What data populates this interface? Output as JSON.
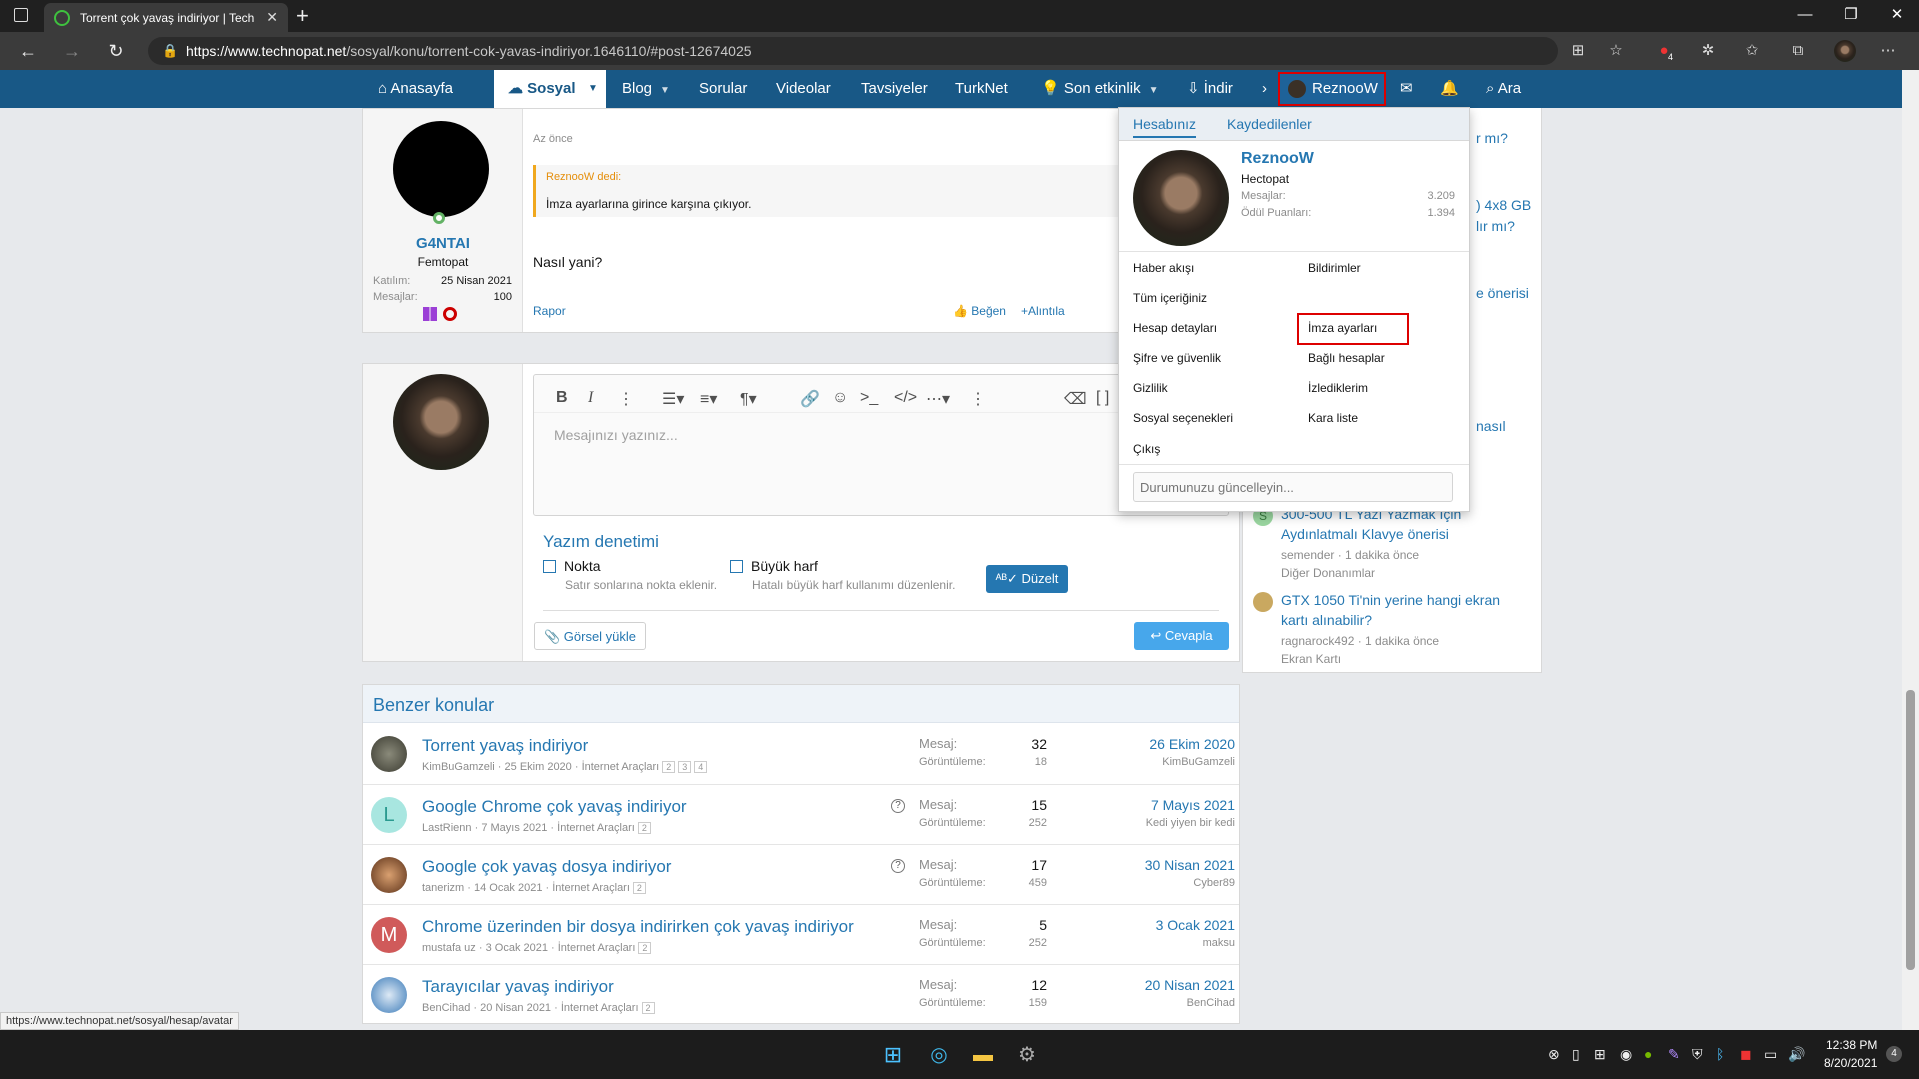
{
  "browser": {
    "tab_title": "Torrent çok yavaş indiriyor | Tech",
    "url_host": "https://www.technopat.net",
    "url_path": "/sosyal/konu/torrent-cok-yavas-indiriyor.1646110/#post-12674025",
    "badge_count": "4"
  },
  "nav": {
    "home": "Anasayfa",
    "sosyal": "Sosyal",
    "blog": "Blog",
    "sorular": "Sorular",
    "videolar": "Videolar",
    "tavsiyeler": "Tavsiyeler",
    "turknet": "TurkNet",
    "son_etkinlik": "Son etkinlik",
    "indir": "İndir",
    "user": "ReznooW",
    "ara": "Ara"
  },
  "post": {
    "time": "Az önce",
    "username": "G4NTAI",
    "rank": "Femtopat",
    "joined_label": "Katılım:",
    "joined_value": "25 Nisan 2021",
    "messages_label": "Mesajlar:",
    "messages_value": "100",
    "quote_author": "ReznooW dedi:",
    "quote_text": "İmza ayarlarına girince karşına çıkıyor.",
    "body": "Nasıl yani?",
    "report": "Rapor",
    "like": "Beğen",
    "quote": "Alıntıla"
  },
  "reply": {
    "placeholder": "Mesajınızı yazınız...",
    "spell_title": "Yazım denetimi",
    "opt1_label": "Nokta",
    "opt1_desc": "Satır sonlarına nokta eklenir.",
    "opt2_label": "Büyük harf",
    "opt2_desc": "Hatalı büyük harf kullanımı düzenlenir.",
    "fix_button": "Düzelt",
    "upload_button": "Görsel yükle",
    "reply_button": "Cevapla"
  },
  "similar": {
    "title": "Benzer konular",
    "mesaj_label": "Mesaj:",
    "goruntuleme_label": "Görüntüleme:",
    "rows": [
      {
        "title": "Torrent yavaş indiriyor",
        "author": "KimBuGamzeli",
        "date": "25 Ekim 2020",
        "forum": "İnternet Araçları",
        "pages": [
          "2",
          "3",
          "4"
        ],
        "messages": "32",
        "views": "18",
        "last_date": "26 Ekim 2020",
        "last_user": "KimBuGamzeli",
        "question": false
      },
      {
        "title": "Google Chrome çok yavaş indiriyor",
        "author": "LastRienn",
        "date": "7 Mayıs 2021",
        "forum": "İnternet Araçları",
        "pages": [
          "2"
        ],
        "messages": "15",
        "views": "252",
        "last_date": "7 Mayıs 2021",
        "last_user": "Kedi yiyen bir kedi",
        "question": true
      },
      {
        "title": "Google çok yavaş dosya indiriyor",
        "author": "tanerizm",
        "date": "14 Ocak 2021",
        "forum": "İnternet Araçları",
        "pages": [
          "2"
        ],
        "messages": "17",
        "views": "459",
        "last_date": "30 Nisan 2021",
        "last_user": "Cyber89",
        "question": true
      },
      {
        "title": "Chrome üzerinden bir dosya indirirken çok yavaş indiriyor",
        "author": "mustafa uz",
        "date": "3 Ocak 2021",
        "forum": "İnternet Araçları",
        "pages": [
          "2"
        ],
        "messages": "5",
        "views": "252",
        "last_date": "3 Ocak 2021",
        "last_user": "maksu",
        "question": false
      },
      {
        "title": "Tarayıcılar yavaş indiriyor",
        "author": "BenCihad",
        "date": "20 Nisan 2021",
        "forum": "İnternet Araçları",
        "pages": [
          "2"
        ],
        "messages": "12",
        "views": "159",
        "last_date": "20 Nisan 2021",
        "last_user": "BenCihad",
        "question": false
      }
    ]
  },
  "sidebar": {
    "frag1": "r mı?",
    "frag2": ") 4x8 GB",
    "frag3": "lır mı?",
    "frag4": "e önerisi",
    "frag5": "nasıl",
    "items": [
      {
        "title": "300-500 TL Yazı Yazmak İçin Aydınlatmalı Klavye önerisi",
        "meta": "semender · 1 dakika önce",
        "forum": "Diğer Donanımlar",
        "initial": "S"
      },
      {
        "title": "GTX 1050 Ti'nin yerine hangi ekran kartı alınabilir?",
        "meta": "ragnarock492 · 1 dakika önce",
        "forum": "Ekran Kartı",
        "initial": ""
      }
    ]
  },
  "account_menu": {
    "tab1": "Hesabınız",
    "tab2": "Kaydedilenler",
    "name": "ReznooW",
    "rank": "Hectopat",
    "messages_label": "Mesajlar:",
    "messages_value": "3.209",
    "points_label": "Ödül Puanları:",
    "points_value": "1.394",
    "links_left": [
      "Haber akışı",
      "Tüm içeriğiniz",
      "Hesap detayları",
      "Şifre ve güvenlik",
      "Gizlilik",
      "Sosyal seçenekleri",
      "Çıkış"
    ],
    "links_right": [
      "Bildirimler",
      "İmza ayarları",
      "Bağlı hesaplar",
      "İzlediklerim",
      "Kara liste"
    ],
    "status_placeholder": "Durumunuzu güncelleyin..."
  },
  "status_url": "https://www.technopat.net/sosyal/hesap/avatar",
  "taskbar": {
    "time": "12:38 PM",
    "date": "8/20/2021",
    "notif": "4"
  },
  "colors": {
    "nav_bg": "#185886",
    "link": "#2577b1",
    "highlight": "#dd0000"
  }
}
